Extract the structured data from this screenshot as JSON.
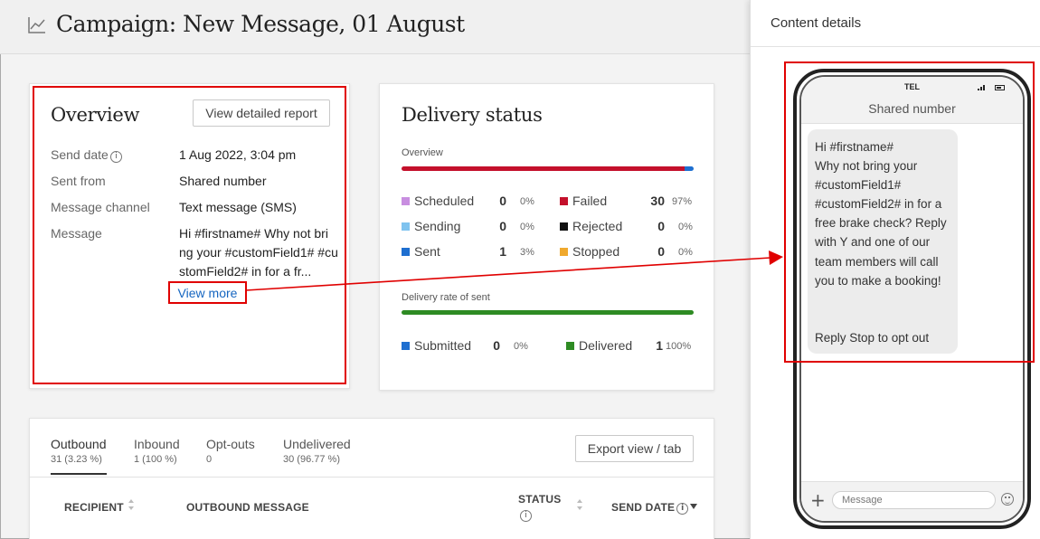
{
  "header": {
    "title": "Campaign: New Message, 01 August"
  },
  "overview": {
    "title": "Overview",
    "report_button": "View detailed report",
    "rows": [
      {
        "label": "Send date",
        "value": "1 Aug 2022, 3:04 pm"
      },
      {
        "label": "Sent from",
        "value": "Shared number"
      },
      {
        "label": "Message channel",
        "value": "Text message (SMS)"
      },
      {
        "label": "Message",
        "value": ""
      }
    ],
    "message_lines": [
      "Hi #firstname# Why not bri",
      "ng your #customField1# #cu",
      "stomField2# in for a fr..."
    ],
    "view_more": "View more"
  },
  "delivery": {
    "title": "Delivery status",
    "overview_label": "Overview",
    "overview_bar": {
      "failed_fraction": 0.97,
      "sent_fraction": 0.03
    },
    "statuses": [
      {
        "name": "Scheduled",
        "count": "0",
        "pct": "0%",
        "color": "#c88ee0"
      },
      {
        "name": "Sending",
        "count": "0",
        "pct": "0%",
        "color": "#7fc3ef"
      },
      {
        "name": "Sent",
        "count": "1",
        "pct": "3%",
        "color": "#1e6fd0"
      },
      {
        "name": "Failed",
        "count": "30",
        "pct": "97%",
        "color": "#c4102b"
      },
      {
        "name": "Rejected",
        "count": "0",
        "pct": "0%",
        "color": "#111111"
      },
      {
        "name": "Stopped",
        "count": "0",
        "pct": "0%",
        "color": "#f0a92e"
      }
    ],
    "rate_label": "Delivery rate of sent",
    "rate_bar": {
      "delivered_fraction": 1.0
    },
    "rate_statuses": [
      {
        "name": "Submitted",
        "count": "0",
        "pct": "0%",
        "color": "#1e6fd0"
      },
      {
        "name": "Delivered",
        "count": "1",
        "pct": "100%",
        "color": "#2e8b23"
      }
    ]
  },
  "tabs": [
    {
      "name": "Outbound",
      "sub": "31 (3.23 %)"
    },
    {
      "name": "Inbound",
      "sub": "1 (100 %)"
    },
    {
      "name": "Opt-outs",
      "sub": "0"
    },
    {
      "name": "Undelivered",
      "sub": "30 (96.77 %)"
    }
  ],
  "export_button": "Export view / tab",
  "table_headers": {
    "recipient": "RECIPIENT",
    "message": "OUTBOUND MESSAGE",
    "status": "STATUS",
    "send_date": "SEND DATE"
  },
  "side_panel": {
    "title": "Content details",
    "carrier": "TEL",
    "contact": "Shared number",
    "bubble_lines": [
      "Hi #firstname#",
      "Why not bring your",
      "#customField1#",
      "#customField2# in for a",
      "free brake check? Reply",
      "with Y and one of our",
      "team members will call",
      "you to make a booking!",
      "",
      "",
      "Reply Stop to opt out"
    ],
    "input_placeholder": "Message"
  },
  "colors": {
    "annotation": "#e00000",
    "link": "#1565c0"
  }
}
